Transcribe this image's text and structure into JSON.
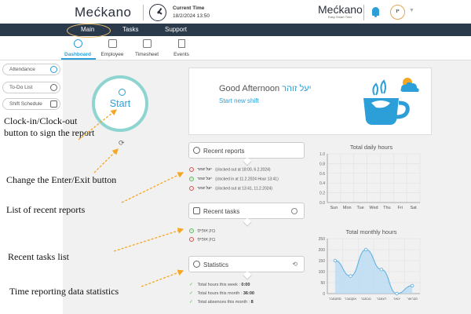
{
  "header": {
    "logo": "Mećkano",
    "time_label": "Current Time",
    "time_value": "18/2/2024 13:50",
    "brand": "Mećkano",
    "brand_sub": "Easy Smart Time",
    "avatar_initials": "יז"
  },
  "nav": {
    "main": "Main",
    "tasks": "Tasks",
    "support": "Support"
  },
  "subnav": [
    {
      "label": "Dashboard",
      "icon": "gauge-icon"
    },
    {
      "label": "Employee",
      "icon": "id-card-icon"
    },
    {
      "label": "Timesheet",
      "icon": "calendar-icon"
    },
    {
      "label": "Events",
      "icon": "flag-icon"
    }
  ],
  "sidebar": {
    "items": [
      "Attendance",
      "To-Do List",
      "Shift Schedule"
    ]
  },
  "start": {
    "label": "Start"
  },
  "greeting": {
    "title": "Good Afternoon",
    "name": "יעל זוהר",
    "subtitle": "Start new shift"
  },
  "sections": {
    "reports": "Recent reports",
    "tasks": "Recent tasks",
    "statistics": "Statistics"
  },
  "reports": [
    {
      "name": "יעל זוהר",
      "detail": "(clocked out at 18:00, 6.2.2024)",
      "kind": "out"
    },
    {
      "name": "יעל זוהר",
      "detail": "(clocked in at 11.2.2024 Hour 13:41)",
      "kind": "in"
    },
    {
      "name": "יעל זוהר",
      "detail": "(clocked out at 13:41, 11.2.2024)",
      "kind": "out"
    }
  ],
  "tasks": [
    "בוק אופיס",
    "בוק אופיס"
  ],
  "stats": [
    {
      "label": "Total hours this week :",
      "value": "0:00"
    },
    {
      "label": "Total hours this month :",
      "value": "36:00"
    },
    {
      "label": "Total absences this month :",
      "value": "8"
    }
  ],
  "annotations": {
    "clock": "Clock-in/Clock-out button to sign the report",
    "switch": "Change the Enter/Exit button",
    "reports": "List of recent reports",
    "tasks": "Recent tasks list",
    "stats": "Time reporting data statistics"
  },
  "colors": {
    "accent": "#2c9fd9",
    "nav": "#2a3a4a",
    "arrow": "#f5a623"
  },
  "chart_data": [
    {
      "type": "line",
      "title": "Total daily hours",
      "categories": [
        "Sun",
        "Mon",
        "Tue",
        "Wed",
        "Thu",
        "Fri",
        "Sat"
      ],
      "values": [
        0,
        0,
        0,
        0,
        0,
        0,
        0
      ],
      "ylim": [
        0,
        1.0
      ],
      "yticks": [
        "0.0",
        "0.2",
        "0.4",
        "0.6",
        "0.8",
        "1.0"
      ]
    },
    {
      "type": "area",
      "title": "Total monthly hours",
      "categories": [
        "ספטמבר",
        "אוקטובר",
        "נובמבר",
        "דצמבר",
        "ינואר",
        "פברואר"
      ],
      "x_labels_shown": [
        "ספטמבר",
        "אוקטובר",
        "נובמבר",
        "דצמבר",
        "ינואר",
        "פברואר"
      ],
      "values": [
        150,
        80,
        200,
        110,
        0,
        36
      ],
      "ylim": [
        0,
        250
      ],
      "yticks": [
        "0",
        "50",
        "100",
        "150",
        "200",
        "250"
      ]
    }
  ]
}
